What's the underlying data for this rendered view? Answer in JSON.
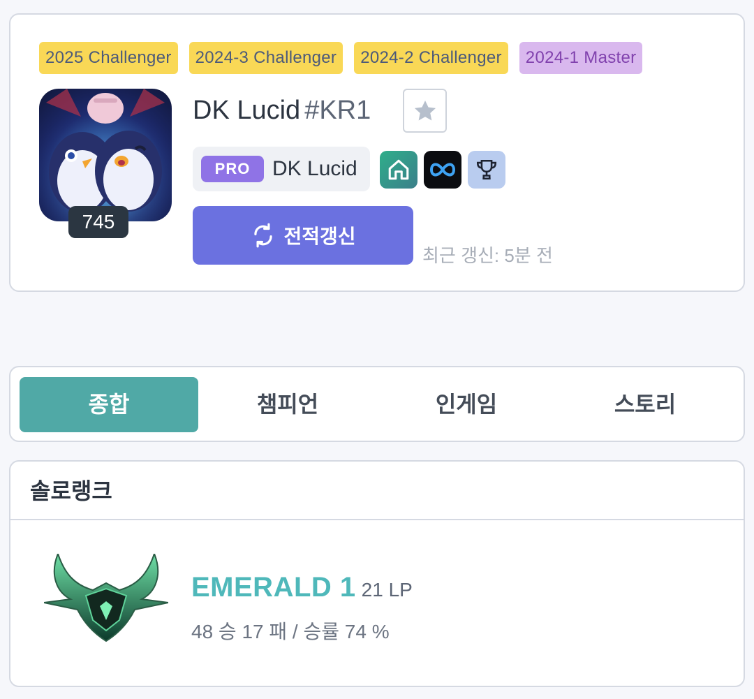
{
  "profile": {
    "season_tags": [
      {
        "label": "2025  Challenger",
        "kind": "challenger"
      },
      {
        "label": "2024-3  Challenger",
        "kind": "challenger"
      },
      {
        "label": "2024-2  Challenger",
        "kind": "challenger"
      },
      {
        "label": "2024-1  Master",
        "kind": "master"
      }
    ],
    "level": "745",
    "summoner_name": "DK Lucid",
    "summoner_tag": "#KR1",
    "favorite_icon": "star-icon",
    "pro_badge": "PRO",
    "pro_name": "DK Lucid",
    "social_icons": [
      "home-icon",
      "infinity-icon",
      "trophy-icon"
    ],
    "refresh_label": "전적갱신",
    "last_updated": "최근 갱신: 5분 전"
  },
  "tabs": [
    {
      "label": "종합",
      "active": true
    },
    {
      "label": "챔피언",
      "active": false
    },
    {
      "label": "인게임",
      "active": false
    },
    {
      "label": "스토리",
      "active": false
    }
  ],
  "solo_rank": {
    "title": "솔로랭크",
    "tier": "EMERALD 1",
    "lp": "21 LP",
    "record": "48 승 17 패 / 승률 74 %"
  },
  "colors": {
    "challenger_tag": "#f9d856",
    "master_tag": "#d9b8ee",
    "active_tab": "#50a9a6",
    "refresh_button": "#6b71e0",
    "pro_badge": "#8f73e6",
    "tier_text": "#4fb8ba"
  }
}
